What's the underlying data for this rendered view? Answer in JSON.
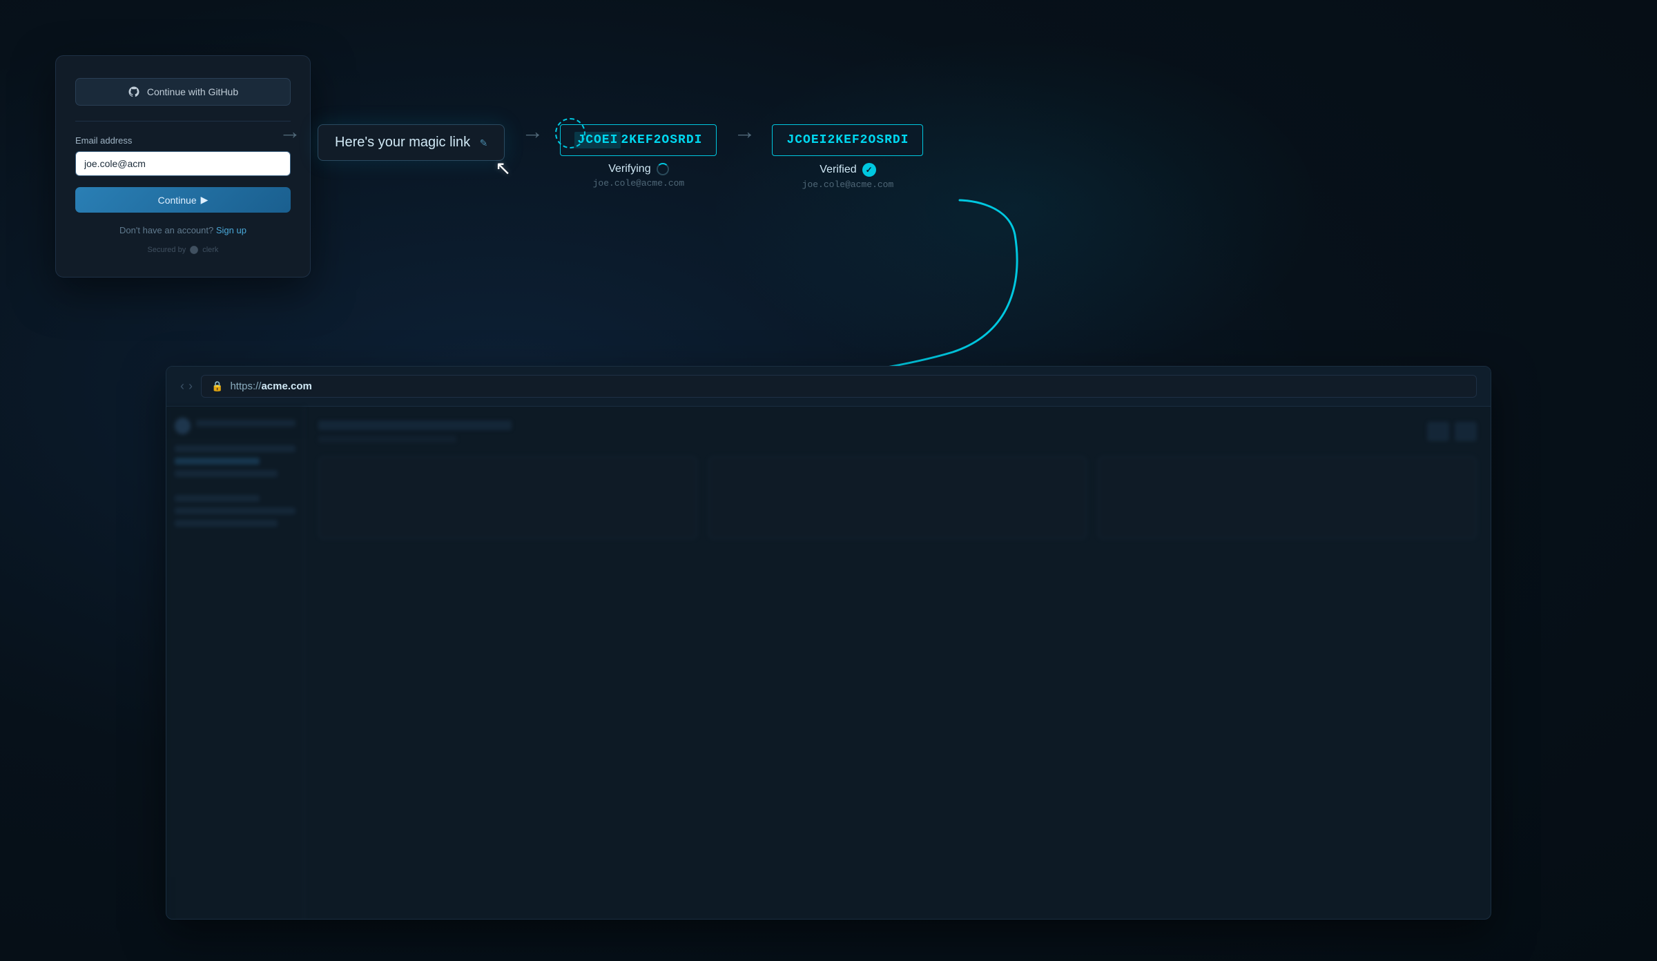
{
  "background": {
    "color": "#0a1520"
  },
  "login_card": {
    "github_btn_label": "Continue with GitHub",
    "email_label": "Email address",
    "email_value": "joe.cole@acm",
    "email_placeholder": "joe.cole@acme.com",
    "continue_btn_label": "Continue",
    "no_account_text": "Don't have an account?",
    "sign_up_label": "Sign up",
    "secured_by_label": "Secured by",
    "clerk_label": "clerk"
  },
  "flow": {
    "magic_link_label": "Here's your magic link",
    "edit_icon": "✎",
    "token": "JCOEI2KEF2OSRDI",
    "token_highlight": "JCOEI",
    "token_rest": "2KEF2OSRDI",
    "verifying_label": "Verifying",
    "verified_label": "Verified",
    "email": "joe.cole@acme.com"
  },
  "browser": {
    "url": "https://acme.com",
    "url_protocol": "https://",
    "url_domain": "acme.com",
    "nav_back": "‹",
    "nav_forward": "›"
  },
  "colors": {
    "accent": "#00c8e0",
    "bg_dark": "#0a1520",
    "bg_card": "#111c28",
    "border": "#1e3045",
    "text_primary": "#d0e8f5",
    "text_muted": "#506878"
  }
}
